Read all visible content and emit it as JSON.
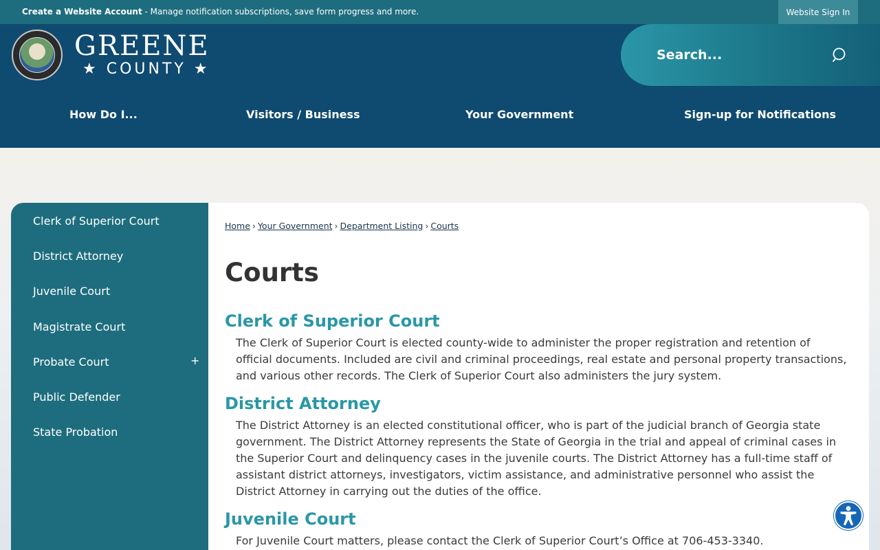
{
  "topbar": {
    "create_account_link": "Create a Website Account",
    "create_account_desc": " - Manage notification subscriptions, save form progress and more.",
    "sign_in": "Website Sign In"
  },
  "logo": {
    "line1": "GREENE",
    "line2": "★ COUNTY ★"
  },
  "search": {
    "placeholder": "Search..."
  },
  "nav": {
    "items": [
      "How Do I...",
      "Visitors / Business",
      "Your Government",
      "Sign-up for Notifications"
    ]
  },
  "sidebar": {
    "items": [
      {
        "label": "Clerk of Superior Court"
      },
      {
        "label": "District Attorney"
      },
      {
        "label": "Juvenile Court"
      },
      {
        "label": "Magistrate Court"
      },
      {
        "label": "Probate Court",
        "toggle": "+"
      },
      {
        "label": "Public Defender"
      },
      {
        "label": "State Probation"
      }
    ]
  },
  "breadcrumb": {
    "items": [
      "Home",
      "Your Government",
      "Department Listing",
      "Courts"
    ],
    "separator": "›"
  },
  "page": {
    "title": "Courts",
    "sections": [
      {
        "heading": "Clerk of Superior Court",
        "body": "The Clerk of Superior Court is elected county-wide to administer the proper registration and retention of official documents. Included are civil and criminal proceedings, real estate and personal property transactions, and various other records. The Clerk of Superior Court also administers the jury system."
      },
      {
        "heading": "District Attorney",
        "body": "The District Attorney is an elected constitutional officer, who is part of the judicial branch of Georgia state government. The District Attorney represents the State of Georgia in the trial and appeal of criminal cases in the Superior Court and delinquency cases in the juvenile courts. The District Attorney has a full-time staff of assistant district attorneys, investigators, victim assistance, and administrative personnel who assist the District Attorney in carrying out the duties of the office."
      },
      {
        "heading": "Juvenile Court",
        "body": "For Juvenile Court matters, please contact the Clerk of Superior Court’s Office at 706-453-3340."
      }
    ]
  },
  "icons": {
    "search": "search-icon",
    "accessibility": "accessibility-icon"
  },
  "colors": {
    "header": "#0f4a70",
    "teal": "#1e6d7e",
    "heading_accent": "#2a97a6"
  }
}
